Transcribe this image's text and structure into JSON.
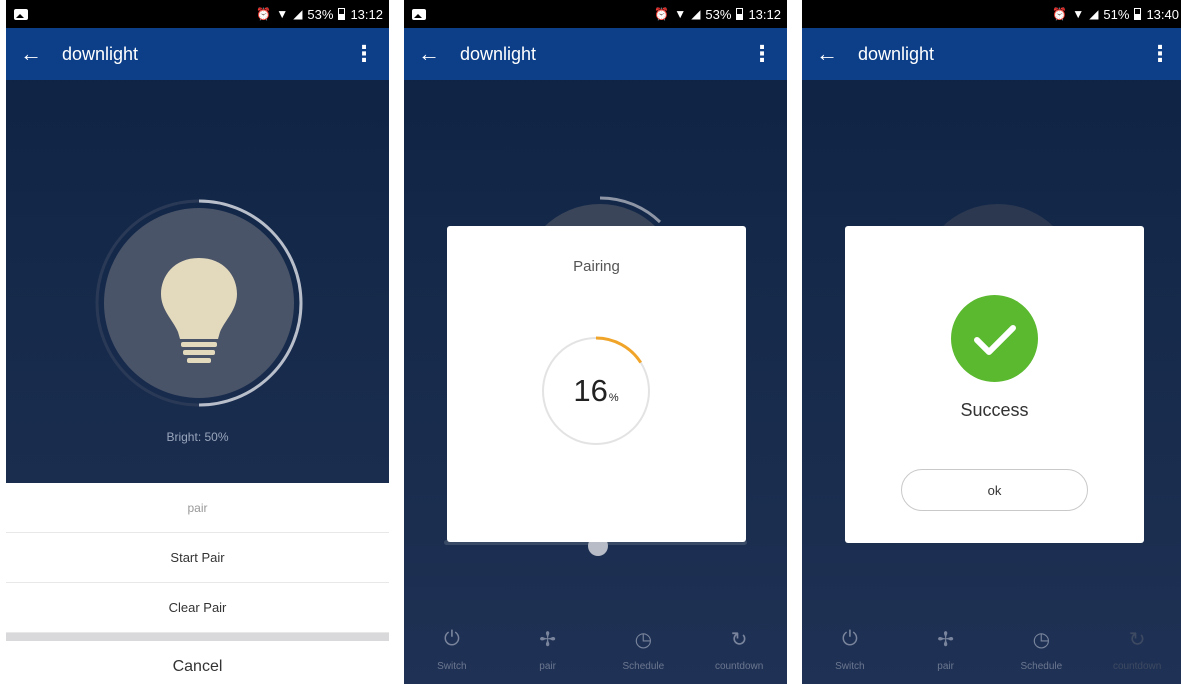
{
  "screens": [
    {
      "status": {
        "time": "13:12",
        "battery": "53%"
      },
      "appbar": {
        "title": "downlight"
      },
      "bright_label": "Bright: 50%",
      "brightness_level": 0.5,
      "sheet": {
        "title": "pair",
        "items": [
          "Start Pair",
          "Clear Pair"
        ],
        "cancel": "Cancel"
      }
    },
    {
      "status": {
        "time": "13:12",
        "battery": "53%"
      },
      "appbar": {
        "title": "downlight"
      },
      "dialog": {
        "title": "Pairing",
        "progress_value": "16",
        "progress_unit": "%",
        "progress_fraction": 0.16
      },
      "tabs": [
        "Switch",
        "pair",
        "Schedule",
        "countdown"
      ]
    },
    {
      "status": {
        "time": "13:40",
        "battery": "51%"
      },
      "appbar": {
        "title": "downlight"
      },
      "dialog": {
        "message": "Success",
        "ok_label": "ok"
      },
      "tabs": [
        "Switch",
        "pair",
        "Schedule",
        "countdown"
      ]
    }
  ],
  "colors": {
    "appbar": "#0c3f88",
    "background": "#15294a",
    "progress_accent": "#f0a52a",
    "success": "#5ab92e"
  },
  "icons": {
    "statusbar": [
      "image-icon",
      "alarm-icon",
      "wifi-icon",
      "signal-icon",
      "battery-icon"
    ],
    "appbar": [
      "back-arrow-icon",
      "overflow-menu-icon"
    ],
    "tabs": [
      "power-icon",
      "pair-icon",
      "clock-icon",
      "countdown-icon"
    ]
  }
}
